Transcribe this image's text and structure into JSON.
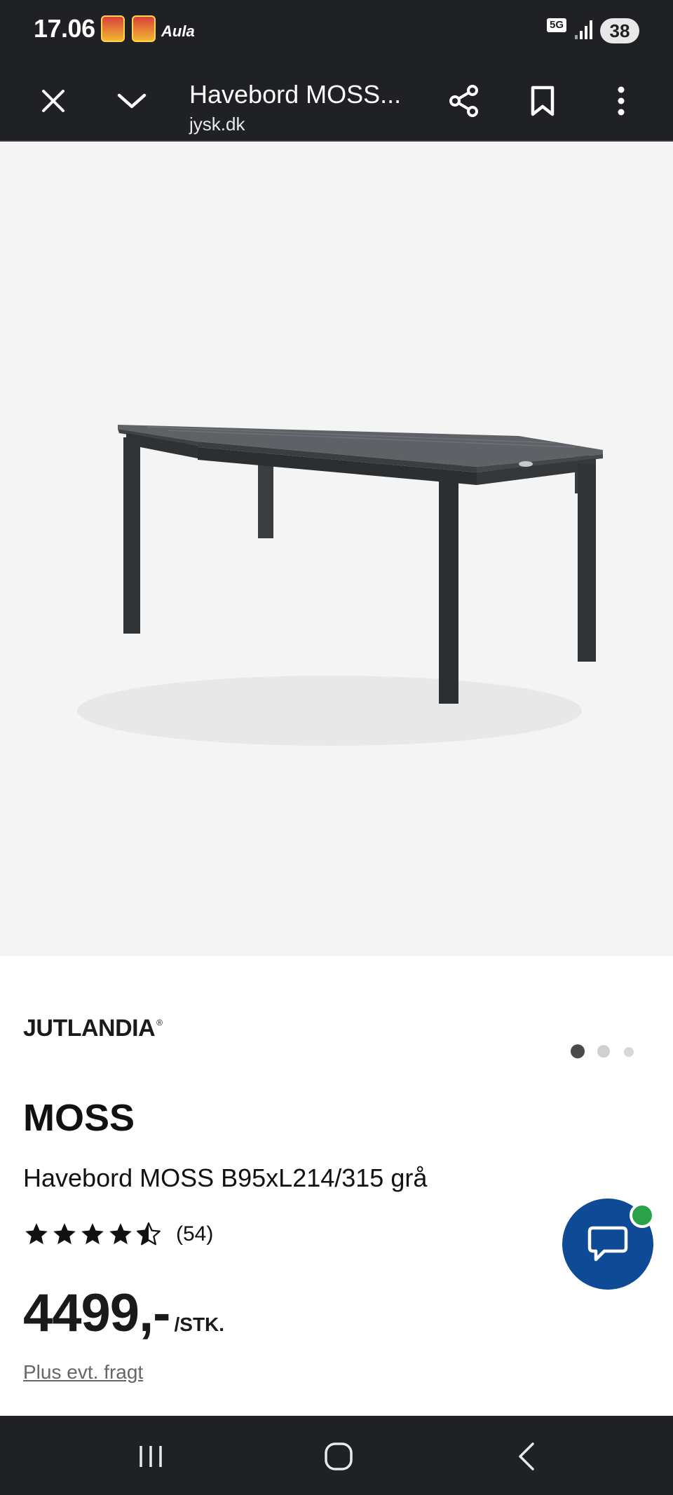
{
  "status_bar": {
    "time": "17.06",
    "app_label": "Aula",
    "network": "5G",
    "battery": "38"
  },
  "toolbar": {
    "title": "Havebord MOSS...",
    "url": "jysk.dk"
  },
  "gallery": {
    "image_count": 3,
    "active_index": 0
  },
  "product": {
    "brand": "JUTLANDIA",
    "brand_mark": "®",
    "name": "MOSS",
    "description": "Havebord MOSS B95xL214/315 grå",
    "rating": 4.5,
    "rating_max": 5,
    "review_count": "(54)",
    "price": "4499,-",
    "price_unit": "/STK.",
    "shipping_link": "Plus evt. fragt"
  },
  "colors": {
    "system_bar": "#202124",
    "gallery_bg": "#f4f4f4",
    "chat_button": "#0f4a97",
    "chat_badge": "#2aa24a"
  },
  "icons": {
    "close": "close-icon",
    "collapse": "chevron-down-icon",
    "share": "share-icon",
    "bookmark": "bookmark-icon",
    "more": "more-vert-icon",
    "chat": "chat-bubble-icon"
  }
}
